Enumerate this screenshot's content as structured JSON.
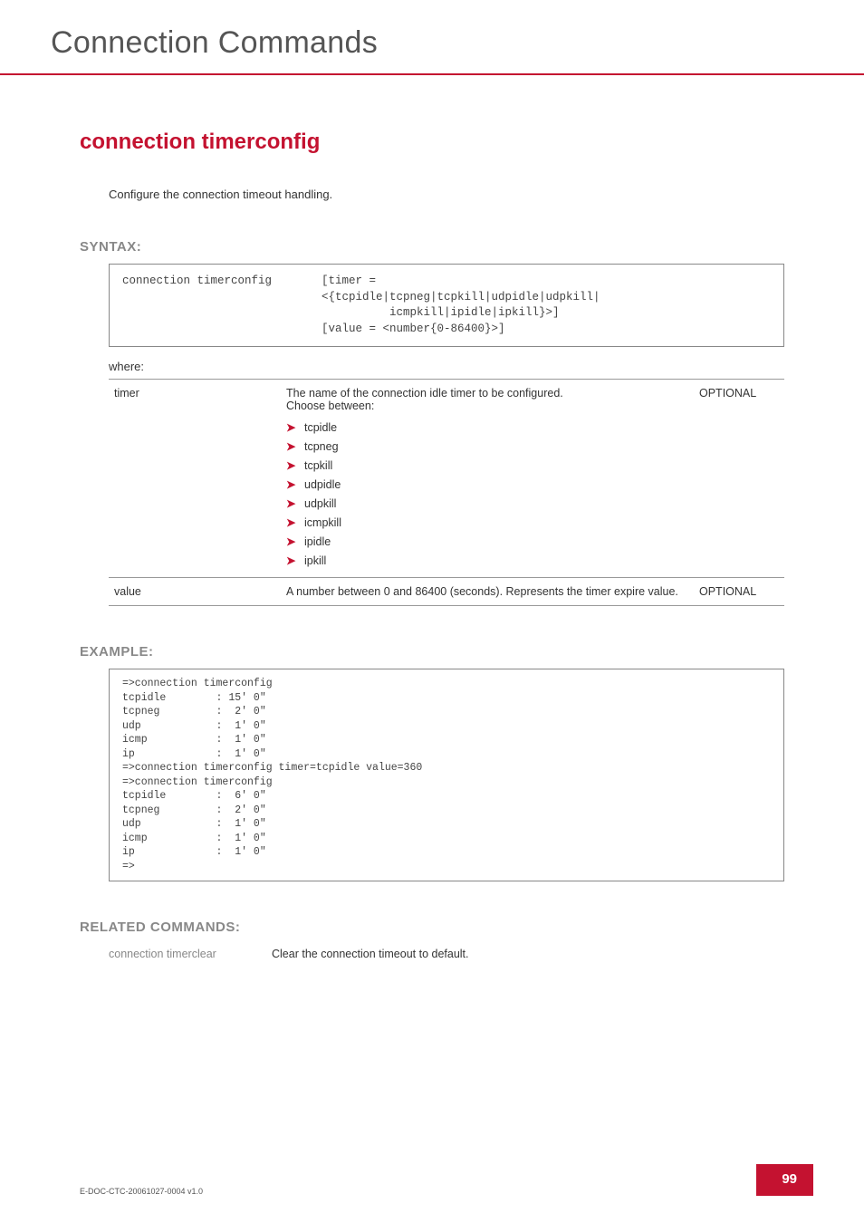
{
  "header": {
    "chapter_title": "Connection Commands"
  },
  "command": {
    "name": "connection timerconfig",
    "summary": "Configure the connection timeout handling."
  },
  "syntax": {
    "heading": "SYNTAX:",
    "cmd": "connection timerconfig",
    "args": "[timer =\n<{tcpidle|tcpneg|tcpkill|udpidle|udpkill|\n          icmpkill|ipidle|ipkill}>]\n[value = <number{0-86400}>]",
    "where_label": "where:",
    "params": [
      {
        "name": "timer",
        "desc": "The name of the connection idle timer to be configured.\nChoose between:",
        "choices": [
          "tcpidle",
          "tcpneg",
          "tcpkill",
          "udpidle",
          "udpkill",
          "icmpkill",
          "ipidle",
          "ipkill"
        ],
        "optionality": "OPTIONAL"
      },
      {
        "name": "value",
        "desc": "A number between 0 and 86400 (seconds). Represents the timer expire value.",
        "optionality": "OPTIONAL"
      }
    ]
  },
  "example": {
    "heading": "EXAMPLE:",
    "text": "=>connection timerconfig\ntcpidle        : 15' 0\"\ntcpneg         :  2' 0\"\nudp            :  1' 0\"\nicmp           :  1' 0\"\nip             :  1' 0\"\n=>connection timerconfig timer=tcpidle value=360\n=>connection timerconfig\ntcpidle        :  6' 0\"\ntcpneg         :  2' 0\"\nudp            :  1' 0\"\nicmp           :  1' 0\"\nip             :  1' 0\"\n=>"
  },
  "related": {
    "heading": "RELATED COMMANDS:",
    "items": [
      {
        "name": "connection timerclear",
        "desc": "Clear the connection timeout to default."
      }
    ]
  },
  "footer": {
    "doc_id": "E-DOC-CTC-20061027-0004 v1.0",
    "page": "99"
  }
}
